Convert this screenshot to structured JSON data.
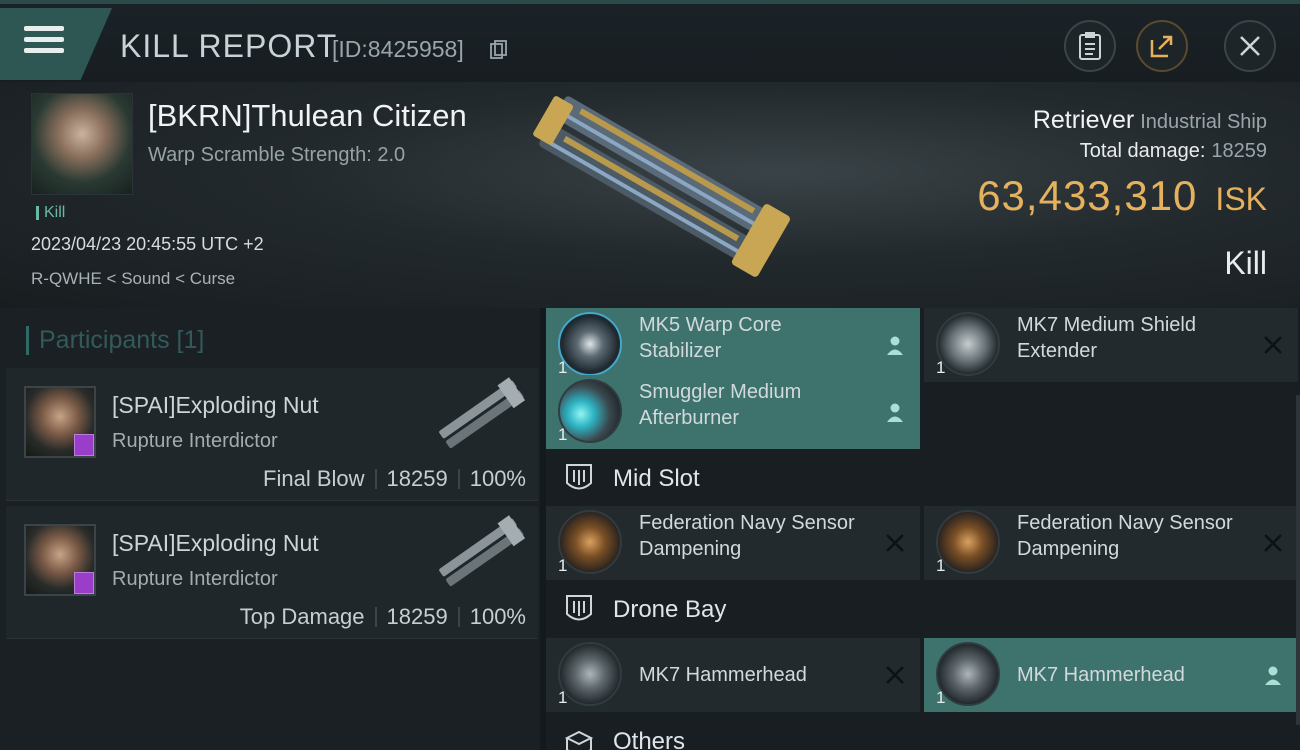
{
  "header": {
    "title": "KILL REPORT",
    "report_id": "[ID:8425958]",
    "icons": {
      "menu": "hamburger-menu-icon",
      "copy": "copy-icon",
      "clipboard": "clipboard-icon",
      "share": "share-icon",
      "close": "close-icon"
    }
  },
  "victim": {
    "pilot": "[BKRN]Thulean Citizen",
    "warp_scramble": "Warp Scramble Strength: 2.0",
    "kill_tag": "Kill",
    "datetime": "2023/04/23 20:45:55 UTC +2",
    "location": "R-QWHE < Sound < Curse",
    "ship": "Retriever",
    "ship_class": "Industrial Ship",
    "total_damage_label": "Total damage:",
    "total_damage": "18259",
    "isk_value": "63,433,310",
    "isk_unit": "ISK",
    "result": "Kill"
  },
  "participants": {
    "header": "Participants [1]",
    "rows": [
      {
        "name": "[SPAI]Exploding Nut",
        "ship": "Rupture Interdictor",
        "role": "Final Blow",
        "damage": "18259",
        "percent": "100%"
      },
      {
        "name": "[SPAI]Exploding Nut",
        "ship": "Rupture Interdictor",
        "role": "Top Damage",
        "damage": "18259",
        "percent": "100%"
      }
    ]
  },
  "modules": {
    "high": [
      {
        "name": "MK5 Warp Core Stabilizer",
        "qty": "1",
        "status": "dropped"
      },
      {
        "name": "MK7 Medium Shield Extender",
        "qty": "1",
        "status": "destroyed"
      },
      {
        "name": "Smuggler Medium Afterburner",
        "qty": "1",
        "status": "dropped"
      }
    ],
    "mid_label": "Mid Slot",
    "mid": [
      {
        "name": "Federation Navy Sensor Dampening",
        "qty": "1",
        "status": "destroyed"
      },
      {
        "name": "Federation Navy Sensor Dampening",
        "qty": "1",
        "status": "destroyed"
      }
    ],
    "drone_label": "Drone Bay",
    "drones": [
      {
        "name": "MK7 Hammerhead",
        "qty": "1",
        "status": "destroyed"
      },
      {
        "name": "MK7 Hammerhead",
        "qty": "1",
        "status": "dropped"
      }
    ],
    "others_label": "Others"
  },
  "colors": {
    "accent": "#3e726d",
    "isk": "#e6b15d",
    "badge": "#9a3ec9"
  }
}
